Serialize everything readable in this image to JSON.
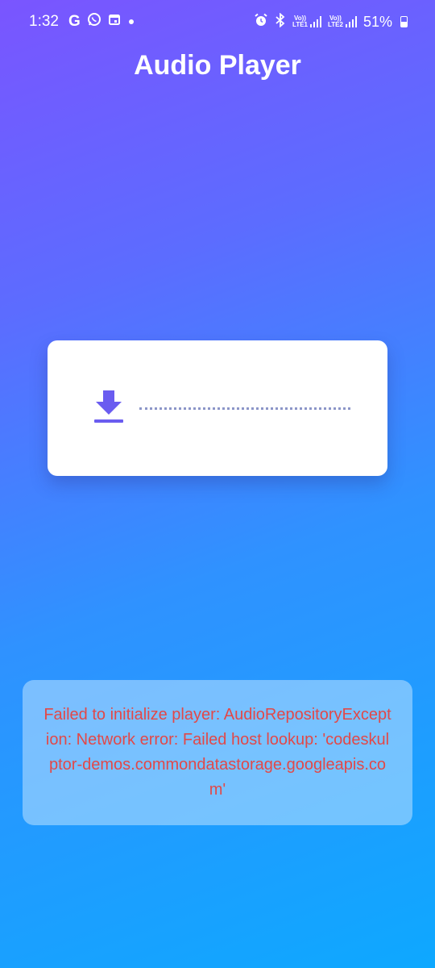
{
  "status_bar": {
    "time": "1:32",
    "icons_left": [
      "google-icon",
      "whatsapp-icon",
      "calendar-icon",
      "dot"
    ],
    "icons_right": [
      "alarm-icon",
      "bluetooth-icon",
      "volte-lte1-signal",
      "volte-lte2-signal",
      "battery-icon"
    ],
    "lte1_label_top": "Vo))",
    "lte1_label_bottom": "LTE1",
    "lte2_label_top": "Vo))",
    "lte2_label_bottom": "LTE2",
    "battery_percent": "51%",
    "battery_level": 0.51
  },
  "header": {
    "title": "Audio Player"
  },
  "player": {
    "download_icon": "download-icon",
    "accent_color": "#6a5cf0",
    "progress": 0
  },
  "error": {
    "message": "Failed to initialize player: AudioRepositoryException: Network error: Failed host lookup: 'codeskulptor-demos.commondatastorage.googleapis.com'",
    "color": "#e24848"
  }
}
